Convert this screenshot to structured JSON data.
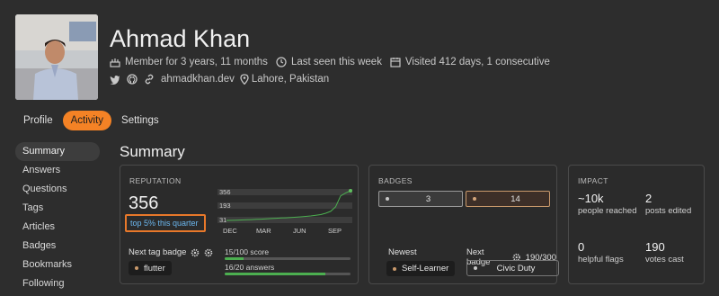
{
  "profile": {
    "name": "Ahmad Khan",
    "member_for": "Member for 3 years, 11 months",
    "last_seen": "Last seen this week",
    "visited": "Visited 412 days, 1 consecutive",
    "website": "ahmadkhan.dev",
    "location": "Lahore, Pakistan",
    "social_icons": [
      "twitter-icon",
      "github-icon",
      "link-icon",
      "location-pin-icon"
    ]
  },
  "tabs": [
    {
      "label": "Profile",
      "active": false
    },
    {
      "label": "Activity",
      "active": true
    },
    {
      "label": "Settings",
      "active": false
    }
  ],
  "sidenav": [
    {
      "label": "Summary",
      "active": true
    },
    {
      "label": "Answers",
      "active": false
    },
    {
      "label": "Questions",
      "active": false
    },
    {
      "label": "Tags",
      "active": false
    },
    {
      "label": "Articles",
      "active": false
    },
    {
      "label": "Badges",
      "active": false
    },
    {
      "label": "Bookmarks",
      "active": false
    },
    {
      "label": "Following",
      "active": false
    }
  ],
  "summary": {
    "title": "Summary",
    "reputation": {
      "title": "REPUTATION",
      "value": "356",
      "rank": "top 5% this quarter",
      "chart_labels": {
        "top": "356",
        "mid": "193",
        "low": "31"
      },
      "months": [
        "DEC",
        "MAR",
        "JUN",
        "SEP"
      ],
      "series": [
        31,
        32,
        34,
        36,
        38,
        40,
        43,
        45,
        48,
        52,
        55,
        58,
        60,
        63,
        66,
        70,
        75,
        80,
        88,
        95,
        110,
        130,
        180,
        300,
        330,
        356
      ],
      "next_tag_label": "Next tag badge",
      "next_tag": "flutter",
      "score_progress": "15/100 score",
      "score_fraction": 0.15,
      "answers_progress": "16/20 answers",
      "answers_fraction": 0.8
    },
    "badges": {
      "title": "BADGES",
      "silver": "3",
      "bronze": "14",
      "newest_label": "Newest",
      "newest": "Self-Learner",
      "next_label": "Next badge",
      "next_progress": "190/300",
      "next_badge": "Civic Duty"
    },
    "impact": {
      "title": "IMPACT",
      "people_reached": "~10k",
      "people_reached_label": "people reached",
      "posts_edited": "2",
      "posts_edited_label": "posts edited",
      "helpful_flags": "0",
      "helpful_flags_label": "helpful flags",
      "votes_cast": "190",
      "votes_cast_label": "votes cast"
    }
  },
  "colors": {
    "accent": "#f48225",
    "link": "#6cb8f0",
    "progress": "#4caf50",
    "bronze_bg": "#3d2f28",
    "bronze_border": "#c9996b",
    "silver_bg": "#3b3b3b",
    "silver_border": "#9a9a9a"
  }
}
